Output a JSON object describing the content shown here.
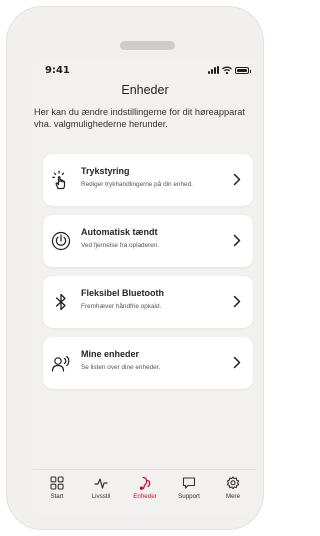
{
  "status": {
    "time": "9:41"
  },
  "header": {
    "title": "Enheder"
  },
  "intro": "Her kan du ændre indstillingerne for dit høreapparat vha. valgmulighederne herunder.",
  "cards": [
    {
      "icon": "touch-icon",
      "title": "Trykstyring",
      "subtitle": "Rediger trykhandlingerne på din enhed."
    },
    {
      "icon": "power-icon",
      "title": "Automatisk tændt",
      "subtitle": "Ved fjernelse fra opladeren."
    },
    {
      "icon": "bluetooth-icon",
      "title": "Fleksibel Bluetooth",
      "subtitle": "Fremhæver håndfrie opkald."
    },
    {
      "icon": "person-voice-icon",
      "title": "Mine enheder",
      "subtitle": "Se listen over dine enheder."
    }
  ],
  "tabs": [
    {
      "label": "Start",
      "icon": "grid-icon"
    },
    {
      "label": "Livsstil",
      "icon": "pulse-icon"
    },
    {
      "label": "Enheder",
      "icon": "hearing-aid-icon",
      "active": true
    },
    {
      "label": "Support",
      "icon": "chat-icon"
    },
    {
      "label": "Mere",
      "icon": "gear-icon"
    }
  ],
  "colors": {
    "accent": "#c8102e",
    "background": "#f3f1ef",
    "card": "#ffffff"
  }
}
